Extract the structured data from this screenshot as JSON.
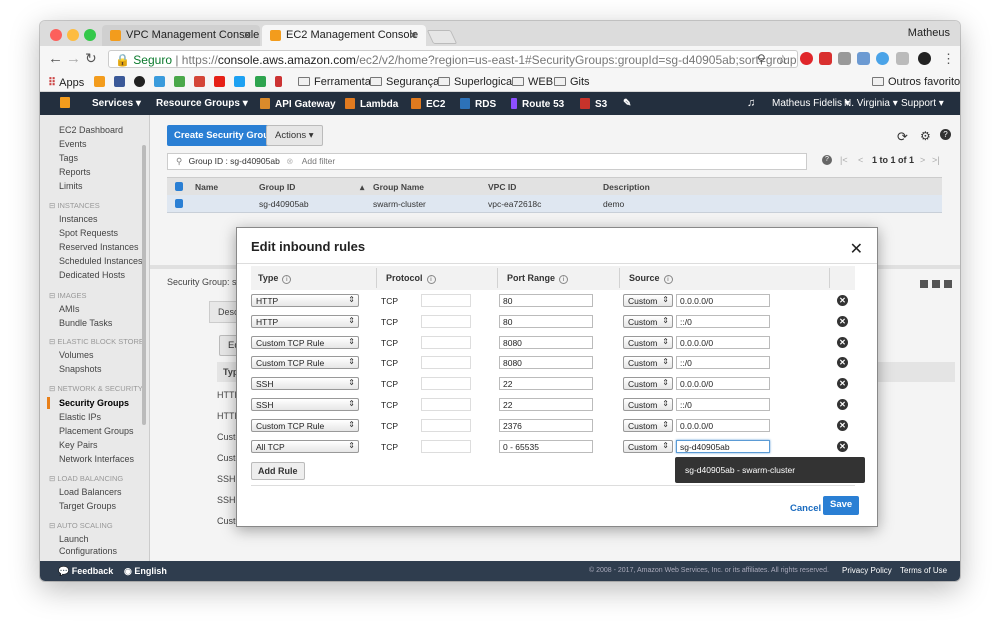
{
  "browser": {
    "tabs": [
      {
        "label": "VPC Management Console"
      },
      {
        "label": "EC2 Management Console"
      }
    ],
    "user": "Matheus",
    "secure_label": "Seguro",
    "url_prefix": "https://",
    "url_host": "console.aws.amazon.com",
    "url_path": "/ec2/v2/home?region=us-east-1#SecurityGroups:groupId=sg-d40905ab;sort=groupId",
    "bookmarks": {
      "apps": "Apps",
      "ferramentas": "Ferramentas",
      "seguranca": "Segurança",
      "superlogica": "Superlogica",
      "web": "WEB",
      "gits": "Gits",
      "outros": "Outros favoritos"
    }
  },
  "aws_nav": {
    "services": "Services",
    "resource_groups": "Resource Groups",
    "api_gateway": "API Gateway",
    "lambda": "Lambda",
    "ec2": "EC2",
    "rds": "RDS",
    "route53": "Route 53",
    "s3": "S3",
    "account": "Matheus Fidelis",
    "region": "N. Virginia",
    "support": "Support"
  },
  "sidebar": {
    "top": [
      "EC2 Dashboard",
      "Events",
      "Tags",
      "Reports",
      "Limits"
    ],
    "instances_hdr": "INSTANCES",
    "instances": [
      "Instances",
      "Spot Requests",
      "Reserved Instances",
      "Scheduled Instances",
      "Dedicated Hosts"
    ],
    "images_hdr": "IMAGES",
    "images": [
      "AMIs",
      "Bundle Tasks"
    ],
    "ebs_hdr": "ELASTIC BLOCK STORE",
    "ebs": [
      "Volumes",
      "Snapshots"
    ],
    "net_hdr": "NETWORK & SECURITY",
    "net": [
      "Security Groups",
      "Elastic IPs",
      "Placement Groups",
      "Key Pairs",
      "Network Interfaces"
    ],
    "lb_hdr": "LOAD BALANCING",
    "lb": [
      "Load Balancers",
      "Target Groups"
    ],
    "as_hdr": "AUTO SCALING",
    "as": [
      "Launch",
      "Configurations"
    ]
  },
  "main": {
    "create_btn": "Create Security Group",
    "actions_btn": "Actions",
    "filter_tag": "Group ID : sg-d40905ab",
    "filter_placeholder": "Add filter",
    "pager": "1 to 1 of 1",
    "columns": [
      "Name",
      "Group ID",
      "Group Name",
      "VPC ID",
      "Description"
    ],
    "row": {
      "name": "",
      "group_id": "sg-d40905ab",
      "group_name": "swarm-cluster",
      "vpc_id": "vpc-ea72618c",
      "description": "demo"
    },
    "sg_label": "Security Group: s",
    "tab_description": "Description",
    "edit_btn": "Edit",
    "type_hdr": "Type",
    "lower_rows": [
      "HTTP",
      "HTTP",
      "Custom TCP Rule",
      "Custom TCP Rule",
      "SSH",
      "SSH",
      "Custom TCP Rule"
    ]
  },
  "modal": {
    "title": "Edit inbound rules",
    "col_type": "Type",
    "col_protocol": "Protocol",
    "col_port": "Port Range",
    "col_source": "Source",
    "rules": [
      {
        "type": "HTTP",
        "protocol": "TCP",
        "port": "80",
        "source_type": "Custom",
        "source": "0.0.0.0/0"
      },
      {
        "type": "HTTP",
        "protocol": "TCP",
        "port": "80",
        "source_type": "Custom",
        "source": "::/0"
      },
      {
        "type": "Custom TCP Rule",
        "protocol": "TCP",
        "port": "8080",
        "source_type": "Custom",
        "source": "0.0.0.0/0"
      },
      {
        "type": "Custom TCP Rule",
        "protocol": "TCP",
        "port": "8080",
        "source_type": "Custom",
        "source": "::/0"
      },
      {
        "type": "SSH",
        "protocol": "TCP",
        "port": "22",
        "source_type": "Custom",
        "source": "0.0.0.0/0"
      },
      {
        "type": "SSH",
        "protocol": "TCP",
        "port": "22",
        "source_type": "Custom",
        "source": "::/0"
      },
      {
        "type": "Custom TCP Rule",
        "protocol": "TCP",
        "port": "2376",
        "source_type": "Custom",
        "source": "0.0.0.0/0"
      },
      {
        "type": "All TCP",
        "protocol": "TCP",
        "port": "0 - 65535",
        "source_type": "Custom",
        "source": "sg-d40905ab"
      }
    ],
    "tooltip": "sg-d40905ab - swarm-cluster",
    "add_rule": "Add Rule",
    "cancel": "Cancel",
    "save": "Save"
  },
  "footer": {
    "feedback": "Feedback",
    "language": "English",
    "copyright": "© 2008 - 2017, Amazon Web Services, Inc. or its affiliates. All rights reserved.",
    "privacy": "Privacy Policy",
    "terms": "Terms of Use"
  }
}
